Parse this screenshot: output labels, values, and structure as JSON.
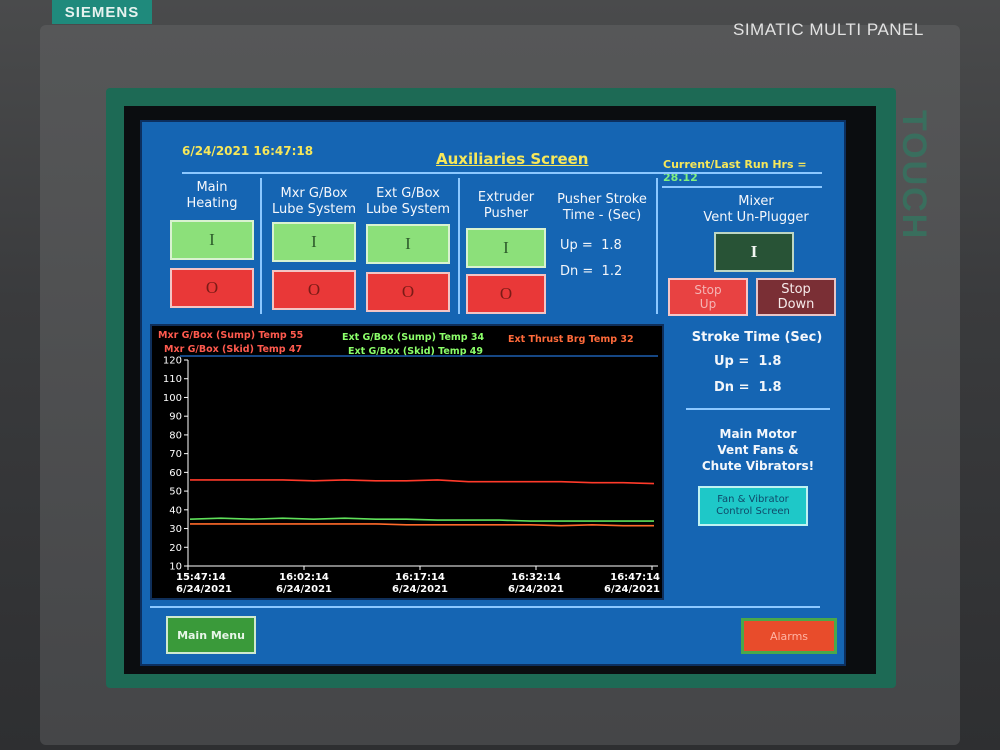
{
  "device": {
    "brand": "SIEMENS",
    "model": "SIMATIC MULTI PANEL",
    "side_label": "TOUCH"
  },
  "header": {
    "datetime": "6/24/2021 16:47:18",
    "title": "Auxiliaries Screen",
    "run_hrs_label": "Current/Last Run Hrs =",
    "run_hrs_value": "28.12"
  },
  "main_heating": {
    "title_line1": "Main",
    "title_line2": "Heating",
    "on_label": "I",
    "off_label": "O"
  },
  "mxr_lube": {
    "title_line1": "Mxr G/Box",
    "title_line2": "Lube System",
    "on_label": "I",
    "off_label": "O"
  },
  "ext_lube": {
    "title_line1": "Ext G/Box",
    "title_line2": "Lube System",
    "on_label": "I",
    "off_label": "O"
  },
  "extruder_pusher": {
    "title_line1": "Extruder",
    "title_line2": "Pusher",
    "on_label": "I",
    "off_label": "O"
  },
  "pusher_stroke": {
    "title_line1": "Pusher Stroke",
    "title_line2": "Time - (Sec)",
    "up_label": "Up =",
    "up_value": "1.8",
    "dn_label": "Dn =",
    "dn_value": "1.2"
  },
  "mixer_vent": {
    "title_line1": "Mixer",
    "title_line2": "Vent Un-Plugger",
    "on_label": "I",
    "stop_up_line1": "Stop",
    "stop_up_line2": "Up",
    "stop_down_line1": "Stop",
    "stop_down_line2": "Down"
  },
  "stroke_time": {
    "title": "Stroke Time (Sec)",
    "up_label": "Up =",
    "up_value": "1.8",
    "dn_label": "Dn =",
    "dn_value": "1.8"
  },
  "main_motor": {
    "line1": "Main Motor",
    "line2": "Vent Fans &",
    "line3": "Chute Vibrators!",
    "button_line1": "Fan & Vibrator",
    "button_line2": "Control Screen"
  },
  "trend_legend": {
    "mxr_sump": "Mxr G/Box (Sump) Temp  55",
    "mxr_skid": "Mxr G/Box (Skid) Temp  47",
    "ext_sump": "Ext G/Box (Sump) Temp   34",
    "ext_skid": "Ext G/Box (Skid) Temp   49",
    "ext_thrust": "Ext Thrust Brg Temp  32"
  },
  "bottom": {
    "main_menu": "Main Menu",
    "alarms": "Alarms"
  },
  "colors": {
    "screen_bg": "#1565b3",
    "on_button": "#8ce07a",
    "off_button": "#e93838",
    "accent_yellow": "#f6e75a",
    "trend_red": "#ff3a2a",
    "trend_green": "#5fe05a",
    "trend_orange": "#ff6a2a"
  },
  "chart_data": {
    "type": "line",
    "y_ticks": [
      "120",
      "110",
      "100",
      "90",
      "80",
      "70",
      "60",
      "50",
      "40",
      "30",
      "20",
      "10"
    ],
    "ylim": [
      10,
      120
    ],
    "x_ticks": [
      {
        "time": "15:47:14",
        "date": "6/24/2021"
      },
      {
        "time": "16:02:14",
        "date": "6/24/2021"
      },
      {
        "time": "16:17:14",
        "date": "6/24/2021"
      },
      {
        "time": "16:32:14",
        "date": "6/24/2021"
      },
      {
        "time": "16:47:14",
        "date": "6/24/2021"
      }
    ],
    "x_tick_positions": [
      0,
      0.25,
      0.5,
      0.75,
      1.0
    ],
    "series": [
      {
        "color": "#ff3a2a",
        "values": [
          56,
          56,
          56,
          56,
          55.5,
          56,
          55.5,
          55.5,
          56,
          55,
          55,
          55,
          55,
          54.5,
          54.5,
          54
        ]
      },
      {
        "color": "#5fe05a",
        "values": [
          35,
          35.5,
          35,
          35.5,
          35,
          35.5,
          35,
          35,
          34.5,
          34.5,
          34.5,
          34,
          34,
          34,
          34,
          34
        ]
      },
      {
        "color": "#ff6a2a",
        "values": [
          32.5,
          32.5,
          32.5,
          32.5,
          32.5,
          32.5,
          32.5,
          32,
          32,
          32,
          32,
          32,
          31.5,
          32,
          31.5,
          31.5
        ]
      }
    ]
  }
}
